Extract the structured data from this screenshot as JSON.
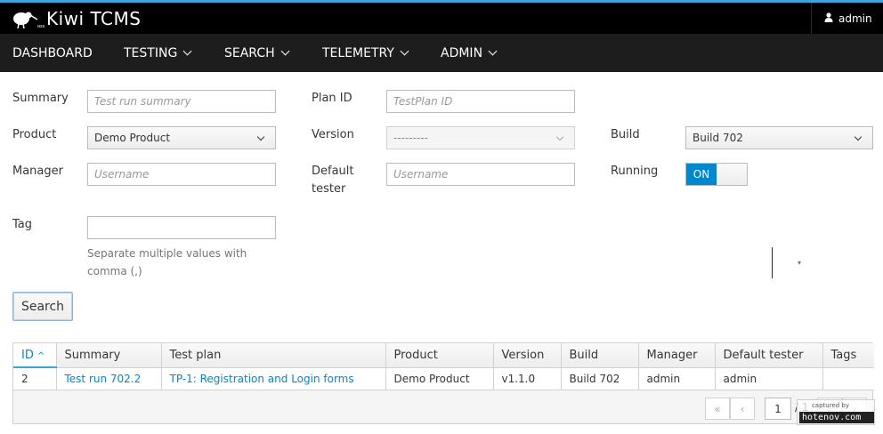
{
  "header": {
    "brand": "Kiwi TCMS",
    "help_icon": "question-circle-icon",
    "user_icon": "user-icon",
    "username": "admin"
  },
  "nav": {
    "items": [
      {
        "label": "DASHBOARD"
      },
      {
        "label": "TESTING"
      },
      {
        "label": "SEARCH"
      },
      {
        "label": "TELEMETRY"
      },
      {
        "label": "ADMIN"
      }
    ]
  },
  "form": {
    "summary_label": "Summary",
    "summary_placeholder": "Test run summary",
    "plan_id_label": "Plan ID",
    "plan_id_placeholder": "TestPlan ID",
    "product_label": "Product",
    "product_value": "Demo Product",
    "version_label": "Version",
    "version_value": "---------",
    "build_label": "Build",
    "build_value": "Build 702",
    "manager_label": "Manager",
    "manager_placeholder": "Username",
    "default_tester_label_1": "Default",
    "default_tester_label_2": "tester",
    "default_tester_placeholder": "Username",
    "running_label": "Running",
    "running_value": "ON",
    "tag_label": "Tag",
    "tag_help": "Separate multiple values with comma (,)",
    "search_button": "Search"
  },
  "table": {
    "columns": [
      "ID",
      "Summary",
      "Test plan",
      "Product",
      "Version",
      "Build",
      "Manager",
      "Default tester",
      "Tags"
    ],
    "sort_indicator": "^",
    "rows": [
      {
        "id": "2",
        "summary": "Test run 702.2",
        "test_plan": "TP-1: Registration and Login forms",
        "product": "Demo Product",
        "version": "v1.1.0",
        "build": "Build 702",
        "manager": "admin",
        "default_tester": "admin",
        "tags": ""
      }
    ]
  },
  "pager": {
    "first": "«",
    "prev": "‹",
    "page": "1",
    "of": "/ 1",
    "next": "›",
    "last": "»"
  },
  "watermark": {
    "caption": "captured by",
    "site": "hotenov.com"
  }
}
